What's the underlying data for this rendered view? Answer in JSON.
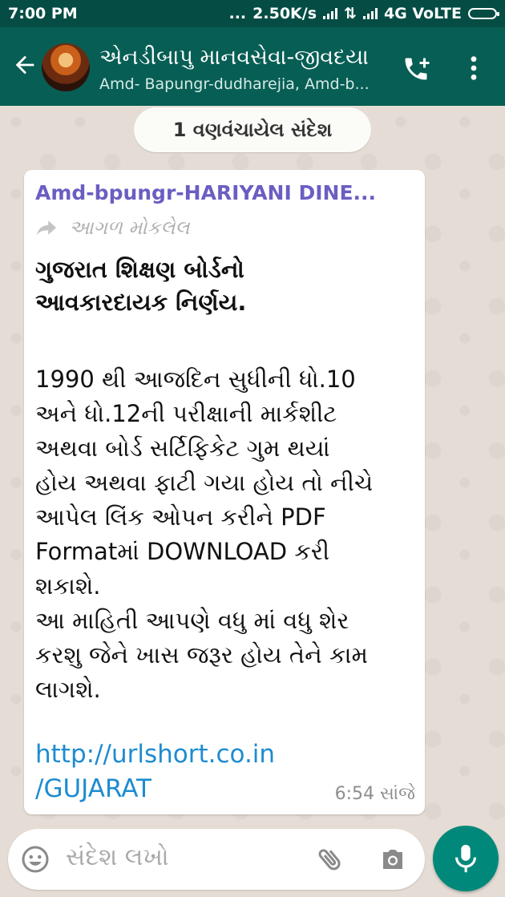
{
  "status_bar": {
    "time": "7:00 PM",
    "speed": "2.50K/s",
    "network": "4G VoLTE",
    "dots": "..."
  },
  "header": {
    "title": "એનડીબાપુ માનવસેવા-જીવદયા",
    "subtitle": "Amd- Bapungr-dudharejia, Amd-b...",
    "icons": [
      "back-arrow-icon",
      "avatar",
      "add-call-icon",
      "more-vert-icon"
    ]
  },
  "unread_banner": "1 વણવંચાયેલ સંદેશ",
  "message": {
    "sender": "Amd-bpungr-HARIYANI DINE...",
    "forwarded_label": "આગળ મોકલેલ",
    "heading_lines": [
      "ગુજરાત શિક્ષણ બોર્ડનો",
      "આવકારદાયક નિર્ણય."
    ],
    "body_lines": [
      "1990 થી આજદિન સુધીની ધો.10",
      "અને ધો.12ની પરીક્ષાની માર્કશીટ",
      "અથવા બોર્ડ સર્ટિફિકેટ ગુમ થયાં",
      "હોય અથવા ફાટી ગયા હોય તો નીચે",
      "આપેલ લિંક ઓપન કરીને PDF",
      "Formatમાં DOWNLOAD કરી",
      "શકાશે.",
      "આ માહિતી આપણે વધુ માં વધુ શેર",
      "કરશુ જેને ખાસ જરૂર હોય તેને કામ",
      "લાગશે."
    ],
    "link_lines": [
      "http://urlshort.co.in",
      "/GUJARAT"
    ],
    "time": "6:54 સાંજે"
  },
  "input": {
    "placeholder": "સંદેશ લખો",
    "icons": [
      "emoji-icon",
      "attach-icon",
      "camera-icon",
      "mic-icon"
    ]
  },
  "colors": {
    "status_bar": "#054d44",
    "header": "#075e54",
    "chat_bg": "#e5ddd5",
    "sender": "#6a5ec2",
    "link": "#1d8cd0",
    "mic_button": "#00897b"
  }
}
